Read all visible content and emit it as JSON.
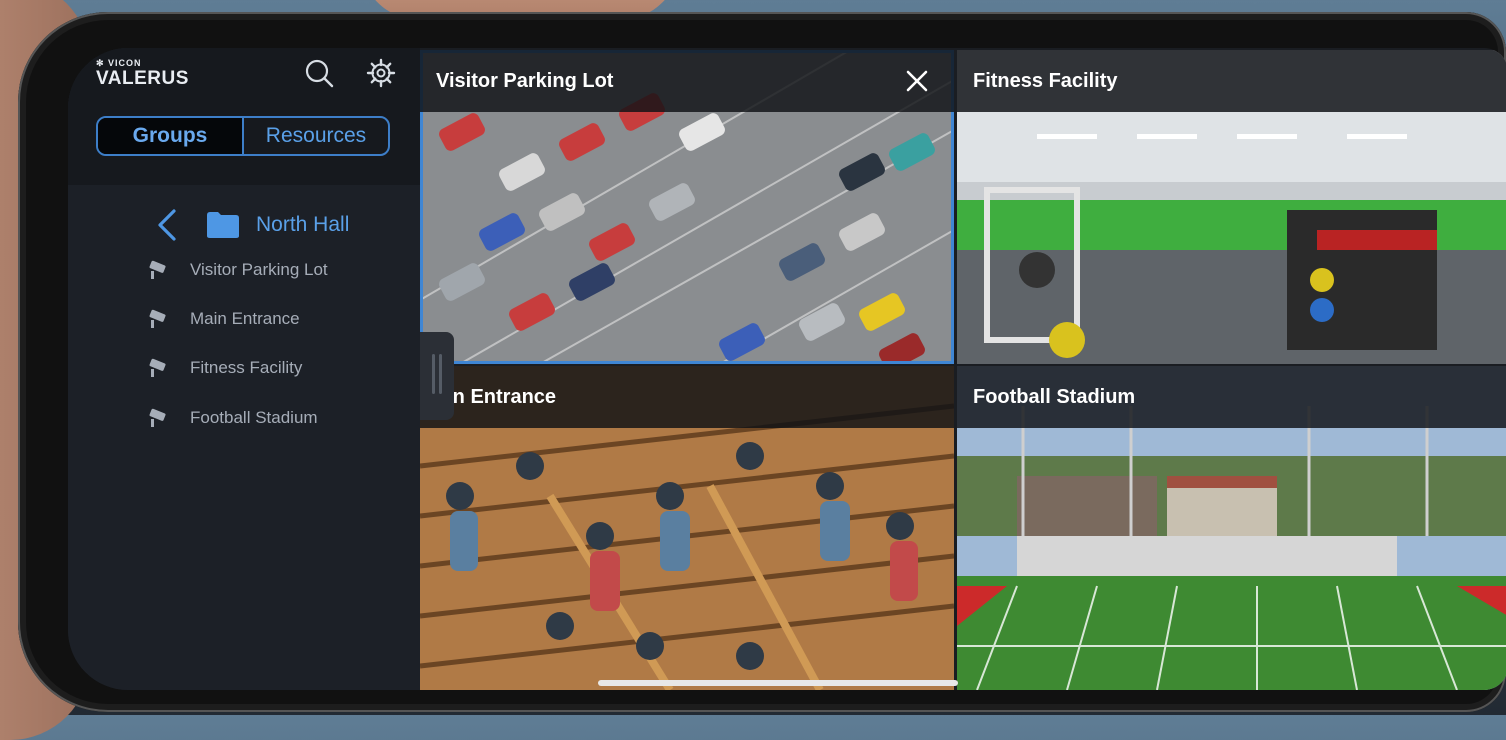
{
  "brand": {
    "vendor": "VICON",
    "product": "VALERUS"
  },
  "header": {
    "search_icon": "search-icon",
    "settings_icon": "gear-icon"
  },
  "segmented": {
    "groups": "Groups",
    "resources": "Resources",
    "selected": "Groups"
  },
  "breadcrumb": {
    "folder": "North Hall"
  },
  "tree": [
    {
      "label": "Visitor Parking Lot",
      "icon": "camera-icon"
    },
    {
      "label": "Main Entrance",
      "icon": "camera-icon"
    },
    {
      "label": "Fitness Facility",
      "icon": "camera-icon"
    },
    {
      "label": "Football Stadium",
      "icon": "camera-icon"
    }
  ],
  "tiles": [
    {
      "title": "Visitor Parking Lot",
      "selected": true
    },
    {
      "title": "Fitness Facility",
      "selected": false
    },
    {
      "title": "ain Entrance",
      "selected": false
    },
    {
      "title": "Football Stadium",
      "selected": false
    }
  ],
  "colors": {
    "accent": "#3f86d4",
    "sidebar": "#1c2027"
  }
}
